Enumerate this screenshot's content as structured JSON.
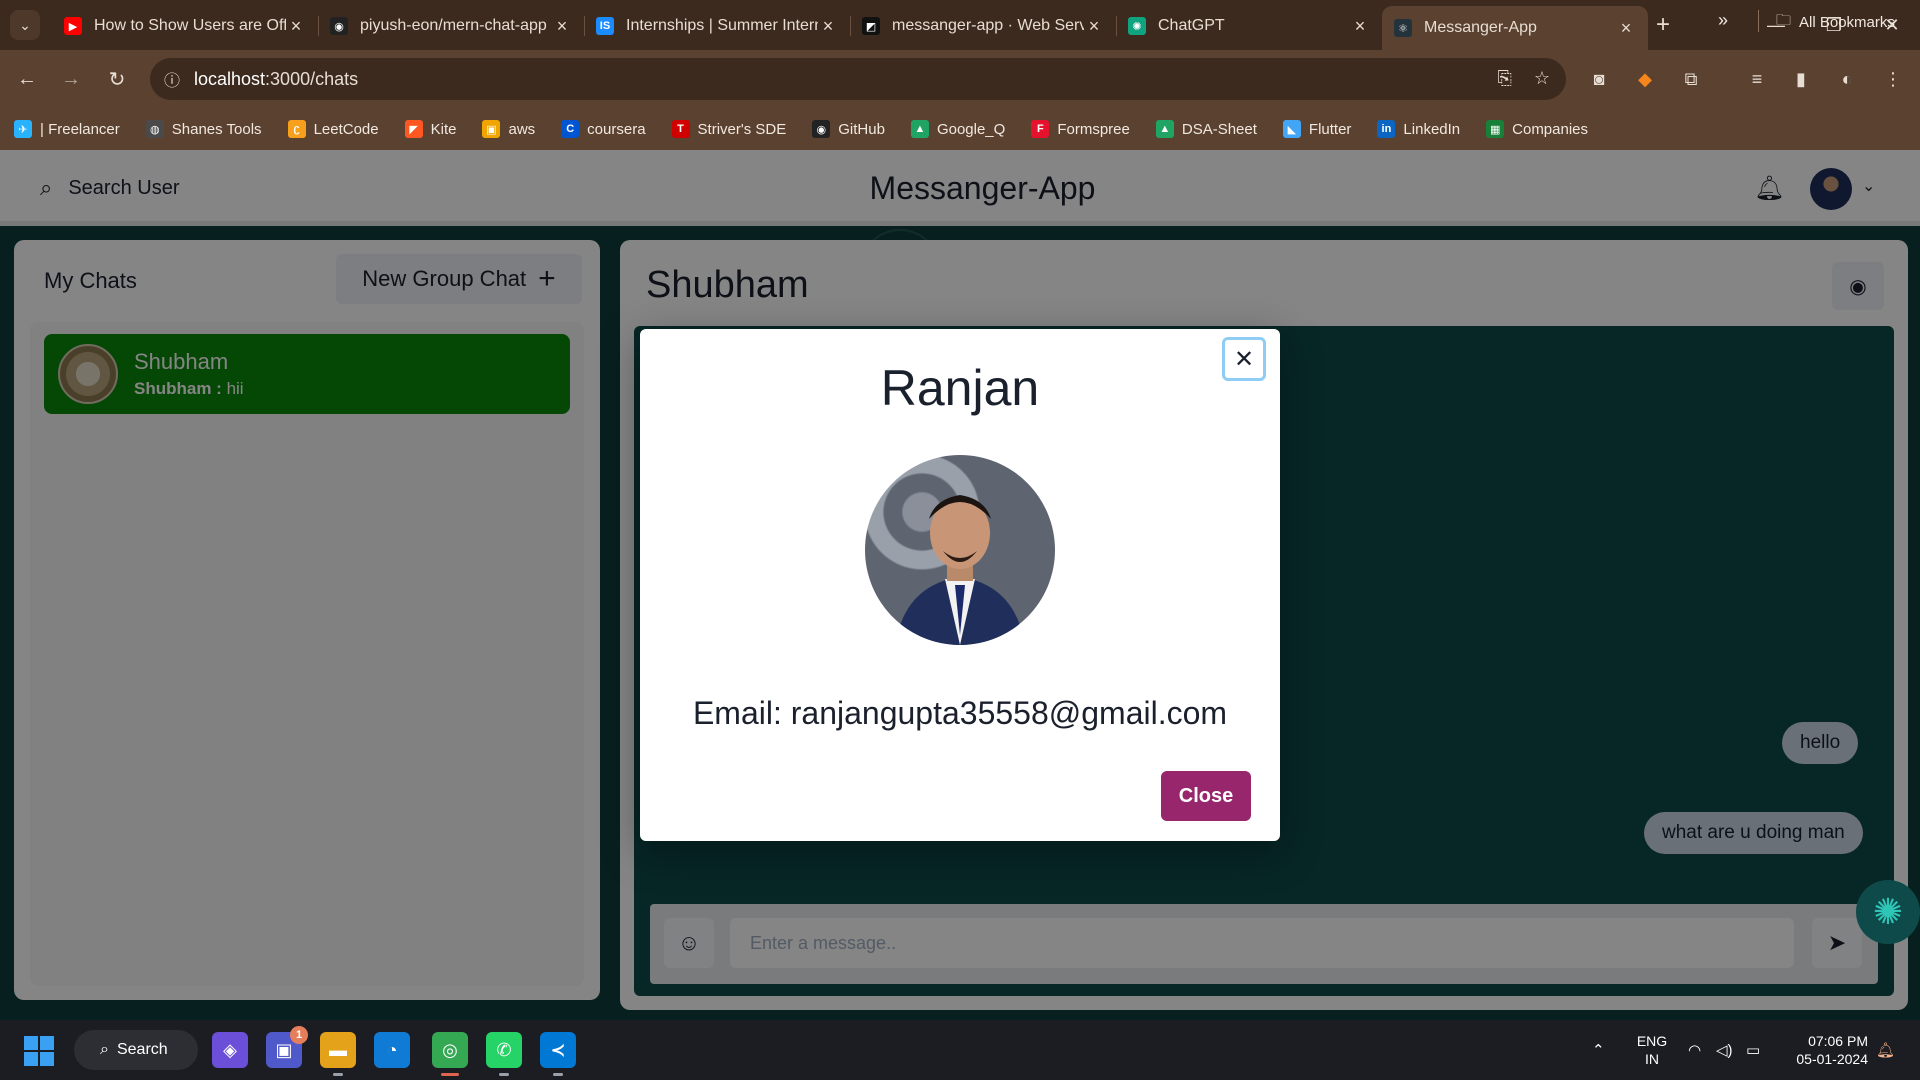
{
  "browser": {
    "tabs": [
      {
        "title": "How to Show Users are Offli",
        "favicon": "youtube-icon",
        "color": "#ff0000",
        "glyph": "▶"
      },
      {
        "title": "piyush-eon/mern-chat-app",
        "favicon": "github-icon",
        "color": "#222222",
        "glyph": "◉"
      },
      {
        "title": "Internships | Summer Intern",
        "favicon": "internshala-icon",
        "color": "#1a8cff",
        "glyph": "IS"
      },
      {
        "title": "messanger-app · Web Serv",
        "favicon": "render-icon",
        "color": "#111111",
        "glyph": "◩"
      },
      {
        "title": "ChatGPT",
        "favicon": "chatgpt-icon",
        "color": "#10a37f",
        "glyph": "✺"
      },
      {
        "title": "Messanger-App",
        "favicon": "react-icon",
        "color": "#23323b",
        "glyph": "⚛",
        "active": true
      }
    ],
    "url_host": "localhost",
    "url_path": ":3000/chats",
    "bookmarks": [
      {
        "label": "| Freelancer",
        "icon": "freelancer-icon",
        "color": "#29b2fe",
        "glyph": "✈"
      },
      {
        "label": "Shanes Tools",
        "icon": "globe-icon",
        "color": "#4a4a4a",
        "glyph": "◍"
      },
      {
        "label": "LeetCode",
        "icon": "leetcode-icon",
        "color": "#f89f1b",
        "glyph": "ʗ"
      },
      {
        "label": "Kite",
        "icon": "kite-icon",
        "color": "#ff5722",
        "glyph": "◤"
      },
      {
        "label": "aws",
        "icon": "aws-icon",
        "color": "#f0a500",
        "glyph": "▣"
      },
      {
        "label": "coursera",
        "icon": "coursera-icon",
        "color": "#0056d2",
        "glyph": "C"
      },
      {
        "label": "Striver's SDE",
        "icon": "tuf-icon",
        "color": "#d10000",
        "glyph": "T"
      },
      {
        "label": "GitHub",
        "icon": "github-icon",
        "color": "#222222",
        "glyph": "◉"
      },
      {
        "label": "Google_Q",
        "icon": "google-drive-icon",
        "color": "#1fa463",
        "glyph": "▲"
      },
      {
        "label": "Formspree",
        "icon": "formspree-icon",
        "color": "#e5122e",
        "glyph": "F"
      },
      {
        "label": "DSA-Sheet",
        "icon": "google-drive-icon",
        "color": "#1fa463",
        "glyph": "▲"
      },
      {
        "label": "Flutter",
        "icon": "flutter-icon",
        "color": "#42a5f5",
        "glyph": "◣"
      },
      {
        "label": "LinkedIn",
        "icon": "linkedin-icon",
        "color": "#0a66c2",
        "glyph": "in"
      },
      {
        "label": "Companies",
        "icon": "sheets-icon",
        "color": "#188038",
        "glyph": "▦"
      }
    ],
    "all_bookmarks": "All Bookmarks"
  },
  "app": {
    "search_label": "Search User",
    "title": "Messanger-App",
    "my_chats": "My Chats",
    "new_group": "New Group Chat",
    "chats": [
      {
        "name": "Shubham",
        "sender": "Shubham :",
        "last": "hii"
      }
    ],
    "current_chat": "Shubham",
    "messages": [
      {
        "text": "hello"
      },
      {
        "text": "what are u doing man"
      }
    ],
    "input_placeholder": "Enter a message..",
    "colors": {
      "accent": "#97266d",
      "selected_chat": "#0a8a0a",
      "chat_bg": "#0f4a4a"
    }
  },
  "modal": {
    "name": "Ranjan",
    "email": "Email: ranjangupta35558@gmail.com",
    "close_label": "Close"
  },
  "taskbar": {
    "search": "Search",
    "lang1": "ENG",
    "lang2": "IN",
    "time": "07:06 PM",
    "date": "05-01-2024",
    "teams_badge": "1"
  }
}
